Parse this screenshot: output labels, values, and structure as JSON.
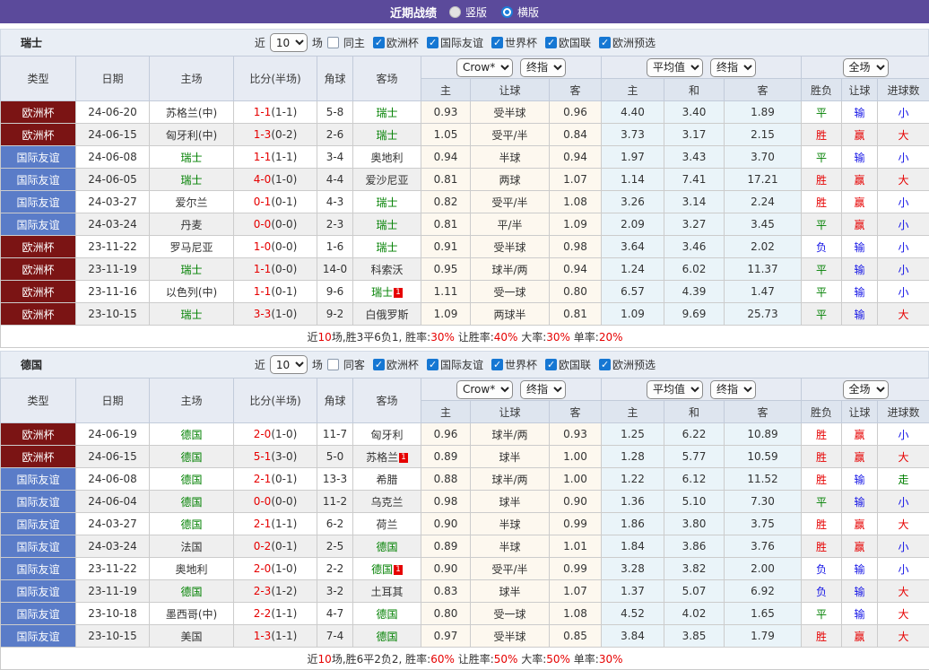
{
  "topbar": {
    "title": "近期战绩",
    "radio_vertical": "竖版",
    "radio_horizontal": "横版"
  },
  "filter_labels": {
    "near": "近",
    "count": "10",
    "games": "场"
  },
  "league_labels": [
    "欧洲杯",
    "国际友谊",
    "世界杯",
    "欧国联",
    "欧洲预选"
  ],
  "dropdowns": {
    "odds_source": "Crow*",
    "final1": "终指",
    "average": "平均值",
    "final2": "终指",
    "scope": "全场"
  },
  "columns": {
    "type": "类型",
    "date": "日期",
    "home": "主场",
    "score": "比分(半场)",
    "corner": "角球",
    "away": "客场",
    "odds_home": "主",
    "odds_handicap": "让球",
    "odds_away": "客",
    "avg_home": "主",
    "avg_draw": "和",
    "avg_away": "客",
    "wdl": "胜负",
    "cover": "让球",
    "goals": "进球数"
  },
  "colors": {
    "topbar_purple": "#5B4A9B",
    "euro_cup_badge": "#7B1414",
    "friendly_badge": "#5A7CC8",
    "focus_team_green": "#008000",
    "score_red": "#E60000",
    "loss_blue": "#1414E6"
  },
  "sections": [
    {
      "team": "瑞士",
      "same_label": "同主",
      "rows": [
        {
          "type": "欧洲杯",
          "tc": "e",
          "date": "24-06-20",
          "home": "苏格兰(中)",
          "hg": 0,
          "hb": "",
          "score": "1-1",
          "half": "(1-1)",
          "corner": "5-8",
          "away": "瑞士",
          "ag": 1,
          "ab": "",
          "o1": "0.93",
          "hc": "受半球",
          "o2": "0.96",
          "a1": "4.40",
          "a2": "3.40",
          "a3": "1.89",
          "r1": "平",
          "c1": "g",
          "r2": "输",
          "c2": "b",
          "r3": "小",
          "c3": "b"
        },
        {
          "type": "欧洲杯",
          "tc": "e",
          "date": "24-06-15",
          "home": "匈牙利(中)",
          "hg": 0,
          "hb": "",
          "score": "1-3",
          "half": "(0-2)",
          "corner": "2-6",
          "away": "瑞士",
          "ag": 1,
          "ab": "",
          "o1": "1.05",
          "hc": "受平/半",
          "o2": "0.84",
          "a1": "3.73",
          "a2": "3.17",
          "a3": "2.15",
          "r1": "胜",
          "c1": "r",
          "r2": "赢",
          "c2": "r",
          "r3": "大",
          "c3": "r"
        },
        {
          "type": "国际友谊",
          "tc": "f",
          "date": "24-06-08",
          "home": "瑞士",
          "hg": 1,
          "hb": "",
          "score": "1-1",
          "half": "(1-1)",
          "corner": "3-4",
          "away": "奥地利",
          "ag": 0,
          "ab": "",
          "o1": "0.94",
          "hc": "半球",
          "o2": "0.94",
          "a1": "1.97",
          "a2": "3.43",
          "a3": "3.70",
          "r1": "平",
          "c1": "g",
          "r2": "输",
          "c2": "b",
          "r3": "小",
          "c3": "b"
        },
        {
          "type": "国际友谊",
          "tc": "f",
          "date": "24-06-05",
          "home": "瑞士",
          "hg": 1,
          "hb": "",
          "score": "4-0",
          "half": "(1-0)",
          "corner": "4-4",
          "away": "爱沙尼亚",
          "ag": 0,
          "ab": "",
          "o1": "0.81",
          "hc": "两球",
          "o2": "1.07",
          "a1": "1.14",
          "a2": "7.41",
          "a3": "17.21",
          "r1": "胜",
          "c1": "r",
          "r2": "赢",
          "c2": "r",
          "r3": "大",
          "c3": "r"
        },
        {
          "type": "国际友谊",
          "tc": "f",
          "date": "24-03-27",
          "home": "爱尔兰",
          "hg": 0,
          "hb": "",
          "score": "0-1",
          "half": "(0-1)",
          "corner": "4-3",
          "away": "瑞士",
          "ag": 1,
          "ab": "",
          "o1": "0.82",
          "hc": "受平/半",
          "o2": "1.08",
          "a1": "3.26",
          "a2": "3.14",
          "a3": "2.24",
          "r1": "胜",
          "c1": "r",
          "r2": "赢",
          "c2": "r",
          "r3": "小",
          "c3": "b"
        },
        {
          "type": "国际友谊",
          "tc": "f",
          "date": "24-03-24",
          "home": "丹麦",
          "hg": 0,
          "hb": "",
          "score": "0-0",
          "half": "(0-0)",
          "corner": "2-3",
          "away": "瑞士",
          "ag": 1,
          "ab": "",
          "o1": "0.81",
          "hc": "平/半",
          "o2": "1.09",
          "a1": "2.09",
          "a2": "3.27",
          "a3": "3.45",
          "r1": "平",
          "c1": "g",
          "r2": "赢",
          "c2": "r",
          "r3": "小",
          "c3": "b"
        },
        {
          "type": "欧洲杯",
          "tc": "e",
          "date": "23-11-22",
          "home": "罗马尼亚",
          "hg": 0,
          "hb": "",
          "score": "1-0",
          "half": "(0-0)",
          "corner": "1-6",
          "away": "瑞士",
          "ag": 1,
          "ab": "",
          "o1": "0.91",
          "hc": "受半球",
          "o2": "0.98",
          "a1": "3.64",
          "a2": "3.46",
          "a3": "2.02",
          "r1": "负",
          "c1": "b",
          "r2": "输",
          "c2": "b",
          "r3": "小",
          "c3": "b"
        },
        {
          "type": "欧洲杯",
          "tc": "e",
          "date": "23-11-19",
          "home": "瑞士",
          "hg": 1,
          "hb": "",
          "score": "1-1",
          "half": "(0-0)",
          "corner": "14-0",
          "away": "科索沃",
          "ag": 0,
          "ab": "",
          "o1": "0.95",
          "hc": "球半/两",
          "o2": "0.94",
          "a1": "1.24",
          "a2": "6.02",
          "a3": "11.37",
          "r1": "平",
          "c1": "g",
          "r2": "输",
          "c2": "b",
          "r3": "小",
          "c3": "b"
        },
        {
          "type": "欧洲杯",
          "tc": "e",
          "date": "23-11-16",
          "home": "以色列(中)",
          "hg": 0,
          "hb": "",
          "score": "1-1",
          "half": "(0-1)",
          "corner": "9-6",
          "away": "瑞士",
          "ag": 1,
          "ab": "1",
          "o1": "1.11",
          "hc": "受一球",
          "o2": "0.80",
          "a1": "6.57",
          "a2": "4.39",
          "a3": "1.47",
          "r1": "平",
          "c1": "g",
          "r2": "输",
          "c2": "b",
          "r3": "小",
          "c3": "b"
        },
        {
          "type": "欧洲杯",
          "tc": "e",
          "date": "23-10-15",
          "home": "瑞士",
          "hg": 1,
          "hb": "",
          "score": "3-3",
          "half": "(1-0)",
          "corner": "9-2",
          "away": "白俄罗斯",
          "ag": 0,
          "ab": "",
          "o1": "1.09",
          "hc": "两球半",
          "o2": "0.81",
          "a1": "1.09",
          "a2": "9.69",
          "a3": "25.73",
          "r1": "平",
          "c1": "g",
          "r2": "输",
          "c2": "b",
          "r3": "大",
          "c3": "r"
        }
      ],
      "summary": [
        {
          "t": "近"
        },
        {
          "t": "10",
          "r": 1
        },
        {
          "t": "场,胜3平6负1, 胜率:"
        },
        {
          "t": "30%",
          "r": 1
        },
        {
          "t": " 让胜率:"
        },
        {
          "t": "40%",
          "r": 1
        },
        {
          "t": " 大率:"
        },
        {
          "t": "30%",
          "r": 1
        },
        {
          "t": " 单率:"
        },
        {
          "t": "20%",
          "r": 1
        }
      ]
    },
    {
      "team": "德国",
      "same_label": "同客",
      "rows": [
        {
          "type": "欧洲杯",
          "tc": "e",
          "date": "24-06-19",
          "home": "德国",
          "hg": 1,
          "hb": "",
          "score": "2-0",
          "half": "(1-0)",
          "corner": "11-7",
          "away": "匈牙利",
          "ag": 0,
          "ab": "",
          "o1": "0.96",
          "hc": "球半/两",
          "o2": "0.93",
          "a1": "1.25",
          "a2": "6.22",
          "a3": "10.89",
          "r1": "胜",
          "c1": "r",
          "r2": "赢",
          "c2": "r",
          "r3": "小",
          "c3": "b"
        },
        {
          "type": "欧洲杯",
          "tc": "e",
          "date": "24-06-15",
          "home": "德国",
          "hg": 1,
          "hb": "",
          "score": "5-1",
          "half": "(3-0)",
          "corner": "5-0",
          "away": "苏格兰",
          "ag": 0,
          "ab": "1",
          "o1": "0.89",
          "hc": "球半",
          "o2": "1.00",
          "a1": "1.28",
          "a2": "5.77",
          "a3": "10.59",
          "r1": "胜",
          "c1": "r",
          "r2": "赢",
          "c2": "r",
          "r3": "大",
          "c3": "r"
        },
        {
          "type": "国际友谊",
          "tc": "f",
          "date": "24-06-08",
          "home": "德国",
          "hg": 1,
          "hb": "",
          "score": "2-1",
          "half": "(0-1)",
          "corner": "13-3",
          "away": "希腊",
          "ag": 0,
          "ab": "",
          "o1": "0.88",
          "hc": "球半/两",
          "o2": "1.00",
          "a1": "1.22",
          "a2": "6.12",
          "a3": "11.52",
          "r1": "胜",
          "c1": "r",
          "r2": "输",
          "c2": "b",
          "r3": "走",
          "c3": "g"
        },
        {
          "type": "国际友谊",
          "tc": "f",
          "date": "24-06-04",
          "home": "德国",
          "hg": 1,
          "hb": "",
          "score": "0-0",
          "half": "(0-0)",
          "corner": "11-2",
          "away": "乌克兰",
          "ag": 0,
          "ab": "",
          "o1": "0.98",
          "hc": "球半",
          "o2": "0.90",
          "a1": "1.36",
          "a2": "5.10",
          "a3": "7.30",
          "r1": "平",
          "c1": "g",
          "r2": "输",
          "c2": "b",
          "r3": "小",
          "c3": "b"
        },
        {
          "type": "国际友谊",
          "tc": "f",
          "date": "24-03-27",
          "home": "德国",
          "hg": 1,
          "hb": "",
          "score": "2-1",
          "half": "(1-1)",
          "corner": "6-2",
          "away": "荷兰",
          "ag": 0,
          "ab": "",
          "o1": "0.90",
          "hc": "半球",
          "o2": "0.99",
          "a1": "1.86",
          "a2": "3.80",
          "a3": "3.75",
          "r1": "胜",
          "c1": "r",
          "r2": "赢",
          "c2": "r",
          "r3": "大",
          "c3": "r"
        },
        {
          "type": "国际友谊",
          "tc": "f",
          "date": "24-03-24",
          "home": "法国",
          "hg": 0,
          "hb": "",
          "score": "0-2",
          "half": "(0-1)",
          "corner": "2-5",
          "away": "德国",
          "ag": 1,
          "ab": "",
          "o1": "0.89",
          "hc": "半球",
          "o2": "1.01",
          "a1": "1.84",
          "a2": "3.86",
          "a3": "3.76",
          "r1": "胜",
          "c1": "r",
          "r2": "赢",
          "c2": "r",
          "r3": "小",
          "c3": "b"
        },
        {
          "type": "国际友谊",
          "tc": "f",
          "date": "23-11-22",
          "home": "奥地利",
          "hg": 0,
          "hb": "",
          "score": "2-0",
          "half": "(1-0)",
          "corner": "2-2",
          "away": "德国",
          "ag": 1,
          "ab": "1",
          "o1": "0.90",
          "hc": "受平/半",
          "o2": "0.99",
          "a1": "3.28",
          "a2": "3.82",
          "a3": "2.00",
          "r1": "负",
          "c1": "b",
          "r2": "输",
          "c2": "b",
          "r3": "小",
          "c3": "b"
        },
        {
          "type": "国际友谊",
          "tc": "f",
          "date": "23-11-19",
          "home": "德国",
          "hg": 1,
          "hb": "",
          "score": "2-3",
          "half": "(1-2)",
          "corner": "3-2",
          "away": "土耳其",
          "ag": 0,
          "ab": "",
          "o1": "0.83",
          "hc": "球半",
          "o2": "1.07",
          "a1": "1.37",
          "a2": "5.07",
          "a3": "6.92",
          "r1": "负",
          "c1": "b",
          "r2": "输",
          "c2": "b",
          "r3": "大",
          "c3": "r"
        },
        {
          "type": "国际友谊",
          "tc": "f",
          "date": "23-10-18",
          "home": "墨西哥(中)",
          "hg": 0,
          "hb": "",
          "score": "2-2",
          "half": "(1-1)",
          "corner": "4-7",
          "away": "德国",
          "ag": 1,
          "ab": "",
          "o1": "0.80",
          "hc": "受一球",
          "o2": "1.08",
          "a1": "4.52",
          "a2": "4.02",
          "a3": "1.65",
          "r1": "平",
          "c1": "g",
          "r2": "输",
          "c2": "b",
          "r3": "大",
          "c3": "r"
        },
        {
          "type": "国际友谊",
          "tc": "f",
          "date": "23-10-15",
          "home": "美国",
          "hg": 0,
          "hb": "",
          "score": "1-3",
          "half": "(1-1)",
          "corner": "7-4",
          "away": "德国",
          "ag": 1,
          "ab": "",
          "o1": "0.97",
          "hc": "受半球",
          "o2": "0.85",
          "a1": "3.84",
          "a2": "3.85",
          "a3": "1.79",
          "r1": "胜",
          "c1": "r",
          "r2": "赢",
          "c2": "r",
          "r3": "大",
          "c3": "r"
        }
      ],
      "summary": [
        {
          "t": "近"
        },
        {
          "t": "10",
          "r": 1
        },
        {
          "t": "场,胜6平2负2, 胜率:"
        },
        {
          "t": "60%",
          "r": 1
        },
        {
          "t": " 让胜率:"
        },
        {
          "t": "50%",
          "r": 1
        },
        {
          "t": " 大率:"
        },
        {
          "t": "50%",
          "r": 1
        },
        {
          "t": " 单率:"
        },
        {
          "t": "30%",
          "r": 1
        }
      ]
    }
  ]
}
